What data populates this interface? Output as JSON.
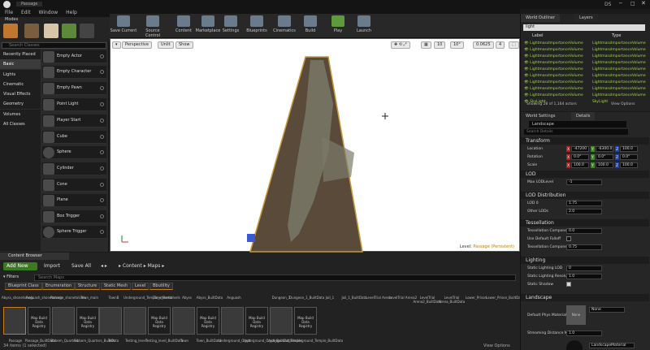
{
  "window": {
    "tab_title": "Passage",
    "user": "DS"
  },
  "menu": [
    "File",
    "Edit",
    "Window",
    "Help"
  ],
  "modes": {
    "title": "Modes"
  },
  "toolbar": [
    {
      "label": "Save Current"
    },
    {
      "label": "Source Control"
    },
    {
      "label": "Content"
    },
    {
      "label": "Marketplace"
    },
    {
      "label": "Settings"
    },
    {
      "label": "Blueprints"
    },
    {
      "label": "Cinematics"
    },
    {
      "label": "Build"
    },
    {
      "label": "Play"
    },
    {
      "label": "Launch"
    }
  ],
  "place": {
    "search_placeholder": "Search Classes",
    "categories": [
      "Recently Placed",
      "Basic",
      "Lights",
      "Cinematic",
      "Visual Effects",
      "Geometry",
      "Volumes",
      "All Classes"
    ],
    "items": [
      "Empty Actor",
      "Empty Character",
      "Empty Pawn",
      "Point Light",
      "Player Start",
      "Cube",
      "Sphere",
      "Cylinder",
      "Cone",
      "Plane",
      "Box Trigger",
      "Sphere Trigger"
    ]
  },
  "viewport": {
    "perspective": "Perspective",
    "lit": "Unlit",
    "show": "Show",
    "grid": "10",
    "rot": "10°",
    "scale": "0.0625",
    "cam": "4",
    "level_label": "Level:",
    "level_name": "Passage (Persistent)"
  },
  "content_browser": {
    "tab": "Content Browser",
    "add_new": "Add New",
    "import": "Import",
    "save_all": "Save All",
    "path": [
      "Content",
      "Maps"
    ],
    "filters": "Filters",
    "search_placeholder": "Search Maps",
    "filter_chips": [
      "Blueprint Class",
      "Enumeration",
      "Structure",
      "Static Mesh",
      "Level",
      "Bbutility"
    ],
    "row1_labels": [
      "Abyss_shonetoIvels",
      "Anguash_shonetoIvels",
      "Passage_shonetoIvels",
      "Town_main",
      "TownB",
      "Underground_Temple_shonetoIvels",
      "Zone_Portal",
      "Abyss",
      "Abyss_BuiltData",
      "Anguash",
      "Dungeon_1",
      "Dungeon_1_BuiltData",
      "Jail_1",
      "Jail_1_BuiltData",
      "LevelTrial Arena",
      "LevelTrial Arena2",
      "LevelTrial Arena2_BuiltData",
      "LevelTrial Arena_BuiltData",
      "Lower_Prison",
      "Lower_Prison_BuiltData"
    ],
    "map_tag": "Map Build Data Registry",
    "row2_labels": [
      "Passage",
      "Passage_BuiltData",
      "Sibbem_Quarters",
      "Sibbem_Quarters_BuiltData",
      "Test",
      "Testing_level",
      "Testing_level_BuiltData",
      "Town",
      "Town_BuiltData",
      "Underground_Crypt",
      "Underground_Crypt_BuiltData",
      "Underground_Temple",
      "Underground_Temple_BuiltData"
    ],
    "status": "34 items (1 selected)",
    "view_options": "View Options"
  },
  "outliner": {
    "tabs": [
      "World Outliner",
      "Layers"
    ],
    "search_value": "light",
    "col_label": "Label",
    "col_type": "Type",
    "rows": [
      {
        "label": "LightmassImportanceVolume",
        "type": "LightmassImportanceVolume"
      },
      {
        "label": "LightmassImportanceVolume",
        "type": "LightmassImportanceVolume"
      },
      {
        "label": "LightmassImportanceVolume",
        "type": "LightmassImportanceVolume"
      },
      {
        "label": "LightmassImportanceVolume",
        "type": "LightmassImportanceVolume"
      },
      {
        "label": "LightmassImportanceVolume",
        "type": "LightmassImportanceVolume"
      },
      {
        "label": "LightmassImportanceVolume",
        "type": "LightmassImportanceVolume"
      },
      {
        "label": "LightmassImportanceVolume",
        "type": "LightmassImportanceVolume"
      },
      {
        "label": "LightmassImportanceVolume",
        "type": "LightmassImportanceVolume"
      },
      {
        "label": "LightmassImportanceVolume",
        "type": "LightmassImportanceVolume"
      },
      {
        "label": "SkyLight",
        "type": "SkyLight"
      }
    ],
    "status": "Showing 28 of 1,164 actors",
    "view_options": "View Options"
  },
  "details": {
    "tabs": [
      "World Settings",
      "Details"
    ],
    "actor": "Landscape",
    "search_placeholder": "Search Details",
    "transform": {
      "title": "Transform",
      "location_label": "Location",
      "rotation_label": "Rotation",
      "scale_label": "Scale",
      "location": [
        "-47200",
        "-6300.0",
        "100.0"
      ],
      "rotation": [
        "0.0°",
        "0.0°",
        "0.0°"
      ],
      "scale": [
        "100.0",
        "100.0",
        "100.0"
      ]
    },
    "lod": {
      "title": "LOD",
      "max_label": "Max LODLevel",
      "max_value": "-1"
    },
    "lod_dist": {
      "title": "LOD Distribution",
      "lod0_label": "LOD 0",
      "lod0": "1.75",
      "other_label": "Other LODs",
      "other": "2.0"
    },
    "tess": {
      "title": "Tessellation",
      "comp_label": "Tessellation Component",
      "comp": "0.0",
      "falloff_label": "Use Default Falloff",
      "comp2": "0.75"
    },
    "lighting": {
      "title": "Lighting",
      "lod_label": "Static Lighting LOD",
      "lod": "0",
      "res_label": "Static Lighting Resolution",
      "res": "1.0",
      "shadow_label": "Static Shadow"
    },
    "landscape": {
      "title": "Landscape",
      "phys_label": "Default Phys Material",
      "phys_none": "None",
      "phys_sel": "None",
      "stream_label": "Streaming Distance M",
      "stream": "1.0",
      "material": "LandscapeMaterial"
    }
  }
}
